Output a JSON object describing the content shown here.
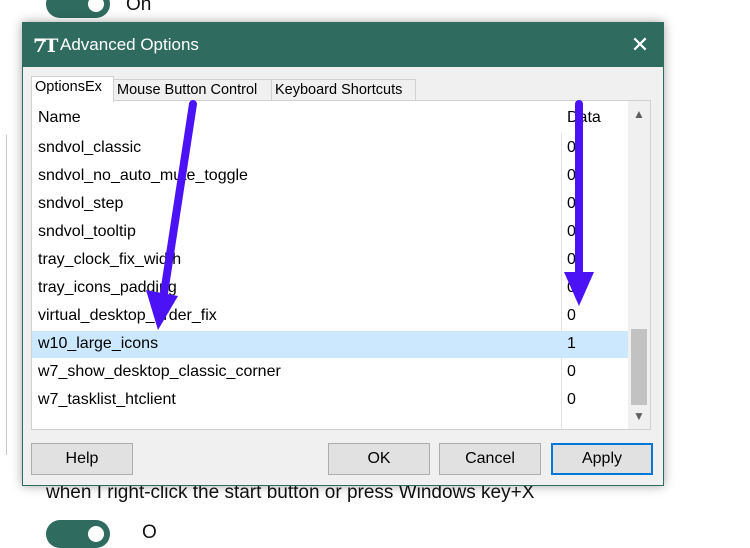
{
  "background": {
    "top_toggle_label": "On",
    "description": "when I right-click the start button or press Windows key+X",
    "bottom_toggle_label": "O"
  },
  "dialog": {
    "title": "Advanced Options",
    "close_glyph": "✕",
    "tabs": [
      {
        "label": "OptionsEx",
        "active": true
      },
      {
        "label": "Mouse Button Control",
        "active": false
      },
      {
        "label": "Keyboard Shortcuts",
        "active": false
      }
    ],
    "columns": {
      "name": "Name",
      "data": "Data"
    },
    "rows": [
      {
        "name": "sndvol_classic",
        "value": "0"
      },
      {
        "name": "sndvol_no_auto_mute_toggle",
        "value": "0"
      },
      {
        "name": "sndvol_step",
        "value": "0"
      },
      {
        "name": "sndvol_tooltip",
        "value": "0"
      },
      {
        "name": "tray_clock_fix_width",
        "value": "0"
      },
      {
        "name": "tray_icons_padding",
        "value": "0"
      },
      {
        "name": "virtual_desktop_order_fix",
        "value": "0"
      },
      {
        "name": "w10_large_icons",
        "value": "1",
        "selected": true
      },
      {
        "name": "w7_show_desktop_classic_corner",
        "value": "0"
      },
      {
        "name": "w7_tasklist_htclient",
        "value": "0"
      }
    ],
    "scroll_up_glyph": "▲",
    "scroll_down_glyph": "▼",
    "buttons": {
      "help": "Help",
      "ok": "OK",
      "cancel": "Cancel",
      "apply": "Apply"
    }
  },
  "colors": {
    "titlebar": "#2f6b5f",
    "selection": "#cce8ff",
    "annotation_arrow": "#4b12f5"
  }
}
